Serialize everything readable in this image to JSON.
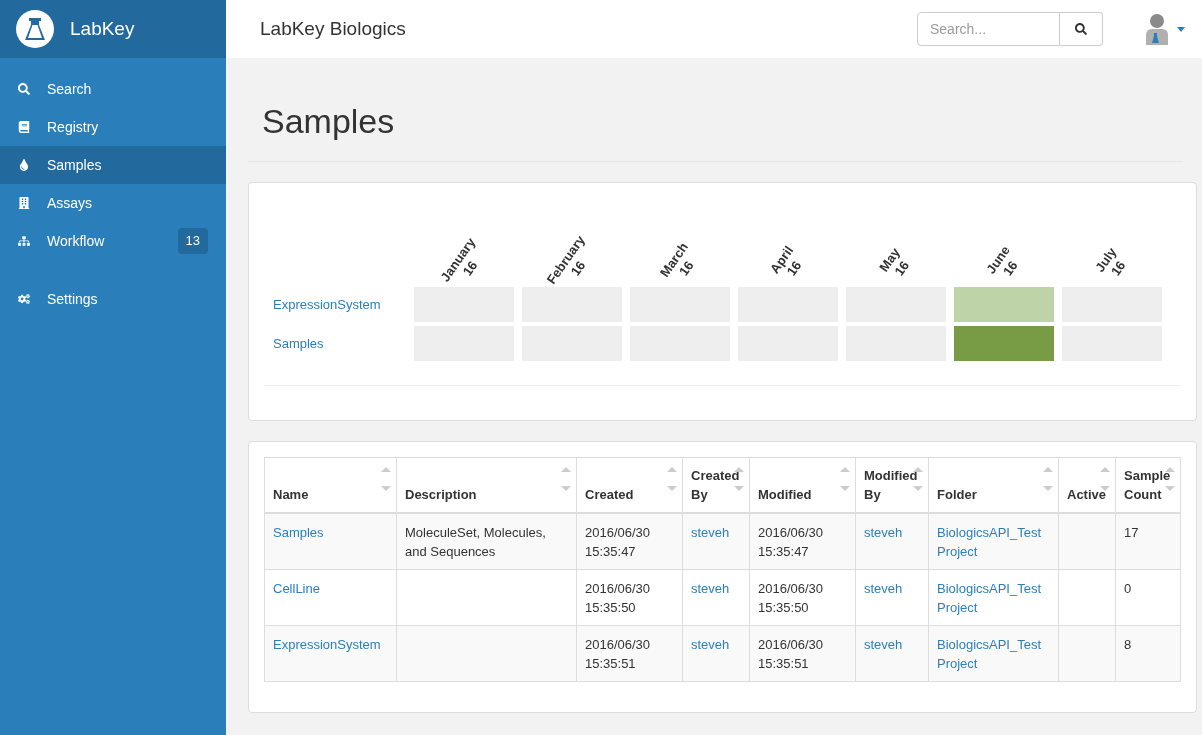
{
  "brand": {
    "name": "LabKey"
  },
  "sidebar": {
    "items": [
      {
        "label": "Search",
        "selected": false
      },
      {
        "label": "Registry",
        "selected": false
      },
      {
        "label": "Samples",
        "selected": true
      },
      {
        "label": "Assays",
        "selected": false
      },
      {
        "label": "Workflow",
        "selected": false,
        "badge": "13"
      },
      {
        "label": "Settings",
        "selected": false
      }
    ]
  },
  "header": {
    "title": "LabKey Biologics",
    "search": {
      "placeholder": "Search..."
    }
  },
  "page": {
    "title": "Samples"
  },
  "heatmap": {
    "months": [
      {
        "month": "January",
        "year": "16"
      },
      {
        "month": "February",
        "year": "16"
      },
      {
        "month": "March",
        "year": "16"
      },
      {
        "month": "April",
        "year": "16"
      },
      {
        "month": "May",
        "year": "16"
      },
      {
        "month": "June",
        "year": "16"
      },
      {
        "month": "July",
        "year": "16"
      }
    ],
    "rows": [
      {
        "label": "ExpressionSystem",
        "cells": [
          {
            "color": "#eeeeee"
          },
          {
            "color": "#eeeeee"
          },
          {
            "color": "#eeeeee"
          },
          {
            "color": "#eeeeee"
          },
          {
            "color": "#eeeeee"
          },
          {
            "color": "#bfd3a8"
          },
          {
            "color": "#eeeeee"
          }
        ]
      },
      {
        "label": "Samples",
        "cells": [
          {
            "color": "#eeeeee"
          },
          {
            "color": "#eeeeee"
          },
          {
            "color": "#eeeeee"
          },
          {
            "color": "#eeeeee"
          },
          {
            "color": "#eeeeee"
          },
          {
            "color": "#779c45"
          },
          {
            "color": "#eeeeee"
          }
        ]
      }
    ]
  },
  "table": {
    "columns": [
      "Name",
      "Description",
      "Created",
      "Created By",
      "Modified",
      "Modified By",
      "Folder",
      "Active",
      "Sample Count"
    ],
    "rows": [
      {
        "name": "Samples",
        "description": "MoleculeSet, Molecules, and Sequences",
        "created": "2016/06/30 15:35:47",
        "created_by": "steveh",
        "modified": "2016/06/30 15:35:47",
        "modified_by": "steveh",
        "folder": "BiologicsAPI_Test Project",
        "sample_count": "17"
      },
      {
        "name": "CellLine",
        "created": "2016/06/30 15:35:50",
        "created_by": "steveh",
        "modified": "2016/06/30 15:35:50",
        "modified_by": "steveh",
        "folder": "BiologicsAPI_Test Project",
        "sample_count": "0"
      },
      {
        "name": "ExpressionSystem",
        "created": "2016/06/30 15:35:51",
        "created_by": "steveh",
        "modified": "2016/06/30 15:35:51",
        "modified_by": "steveh",
        "folder": "BiologicsAPI_Test Project",
        "sample_count": "8"
      }
    ]
  }
}
